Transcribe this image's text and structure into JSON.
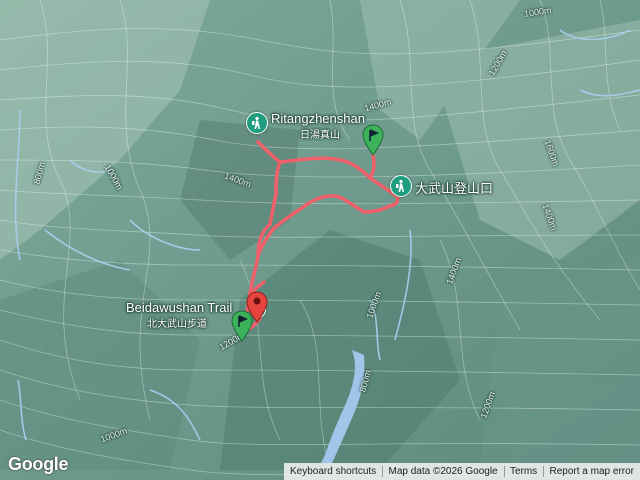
{
  "map": {
    "background_color": "#6f9a8d",
    "contour_color": "#ffffff",
    "water_color": "#9fc6e8",
    "route_color": "#f0606a",
    "contour_labels": [
      "1000m",
      "1200m",
      "1400m",
      "800m",
      "1400m",
      "1600m",
      "1400m",
      "1400m",
      "800m",
      "1000m",
      "1200m",
      "1000m",
      "1000m",
      "1200m"
    ]
  },
  "pois": [
    {
      "icon": "hiker-icon",
      "name_en": "Ritangzhenshan",
      "name_zh": "日湯真山"
    },
    {
      "icon": "hiker-icon",
      "name_zh": "大武山登山口"
    },
    {
      "icon": "hiker-icon",
      "name_en": "Beidawushan Trail",
      "name_zh": "北大武山步道"
    }
  ],
  "markers": [
    {
      "type": "start",
      "color": "#3cb35a",
      "icon": "flag-icon"
    },
    {
      "type": "start",
      "color": "#3cb35a",
      "icon": "flag-icon"
    },
    {
      "type": "end",
      "color": "#e8443f",
      "icon": "dot-icon"
    }
  ],
  "footer": {
    "logo": "Google",
    "keyboard_shortcuts": "Keyboard shortcuts",
    "map_data": "Map data ©2026 Google",
    "terms": "Terms",
    "report": "Report a map error"
  }
}
